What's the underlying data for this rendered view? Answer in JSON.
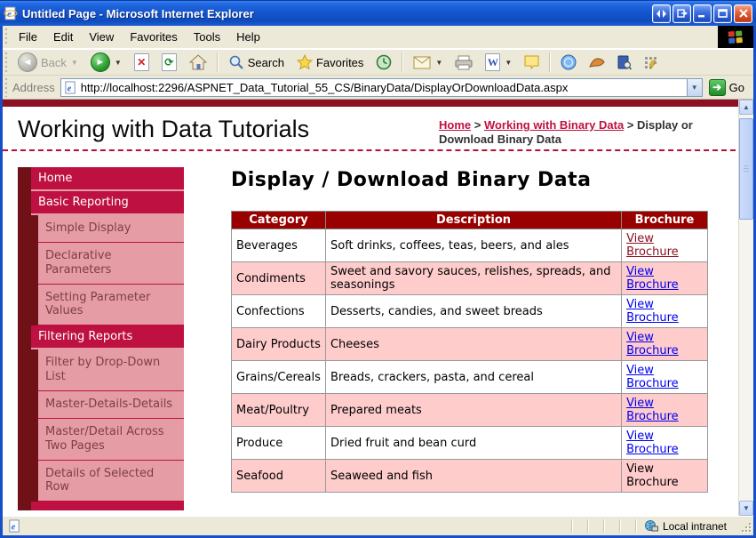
{
  "window": {
    "title": "Untitled Page - Microsoft Internet Explorer"
  },
  "menu": {
    "items": [
      "File",
      "Edit",
      "View",
      "Favorites",
      "Tools",
      "Help"
    ]
  },
  "toolbar": {
    "back": "Back",
    "search": "Search",
    "favorites": "Favorites"
  },
  "address": {
    "label": "Address",
    "url": "http://localhost:2296/ASPNET_Data_Tutorial_55_CS/BinaryData/DisplayOrDownloadData.aspx",
    "go": "Go"
  },
  "icons": {
    "back_arrow": "◄",
    "forward_arrow": "►",
    "dropdown_caret": "▼",
    "stop": "✕",
    "refresh": "⟳",
    "word": "W",
    "go_arrow": "➔",
    "scroll_up": "▲",
    "scroll_down": "▼",
    "breadcrumb_separator": ">"
  },
  "page": {
    "site_title": "Working with Data Tutorials",
    "breadcrumb": [
      {
        "label": "Home",
        "link": true
      },
      {
        "label": "Working with Binary Data",
        "link": true
      },
      {
        "label": "Display or Download Binary Data",
        "link": false
      }
    ],
    "sidebar": [
      {
        "label": "Home",
        "level": 1
      },
      {
        "label": "Basic Reporting",
        "level": 1
      },
      {
        "label": "Simple Display",
        "level": 2
      },
      {
        "label": "Declarative Parameters",
        "level": 2
      },
      {
        "label": "Setting Parameter Values",
        "level": 2
      },
      {
        "label": "Filtering Reports",
        "level": 1
      },
      {
        "label": "Filter by Drop-Down List",
        "level": 2
      },
      {
        "label": "Master-Details-Details",
        "level": 2
      },
      {
        "label": "Master/Detail Across Two Pages",
        "level": 2
      },
      {
        "label": "Details of Selected Row",
        "level": 2
      }
    ],
    "heading": "Display / Download Binary Data",
    "table": {
      "columns": [
        "Category",
        "Description",
        "Brochure"
      ],
      "rows": [
        {
          "category": "Beverages",
          "description": "Soft drinks, coffees, teas, beers, and ales",
          "brochure": "View Brochure",
          "link_style": "visited"
        },
        {
          "category": "Condiments",
          "description": "Sweet and savory sauces, relishes, spreads, and seasonings",
          "brochure": "View Brochure",
          "link_style": "normal"
        },
        {
          "category": "Confections",
          "description": "Desserts, candies, and sweet breads",
          "brochure": "View Brochure",
          "link_style": "normal"
        },
        {
          "category": "Dairy Products",
          "description": "Cheeses",
          "brochure": "View Brochure",
          "link_style": "normal"
        },
        {
          "category": "Grains/Cereals",
          "description": "Breads, crackers, pasta, and cereal",
          "brochure": "View Brochure",
          "link_style": "normal"
        },
        {
          "category": "Meat/Poultry",
          "description": "Prepared meats",
          "brochure": "View Brochure",
          "link_style": "normal"
        },
        {
          "category": "Produce",
          "description": "Dried fruit and bean curd",
          "brochure": "View Brochure",
          "link_style": "normal"
        },
        {
          "category": "Seafood",
          "description": "Seaweed and fish",
          "brochure": "View Brochure",
          "link_style": "none"
        }
      ]
    }
  },
  "status": {
    "zone": "Local intranet"
  },
  "colors": {
    "crimson_accent": "#BE1141",
    "dark_maroon": "#701017",
    "sidebar_pink": "#E59CA5",
    "sidebar_subtext": "#7E3F47",
    "table_header_red": "#990000",
    "row_pink": "#FFCCCC",
    "link_blue": "#0000EE",
    "visited_maroon": "#8E1021",
    "top_bar_maroon": "#8E1023",
    "chrome_tan": "#ECE9D8",
    "titlebar_blue": "#1556CE"
  }
}
